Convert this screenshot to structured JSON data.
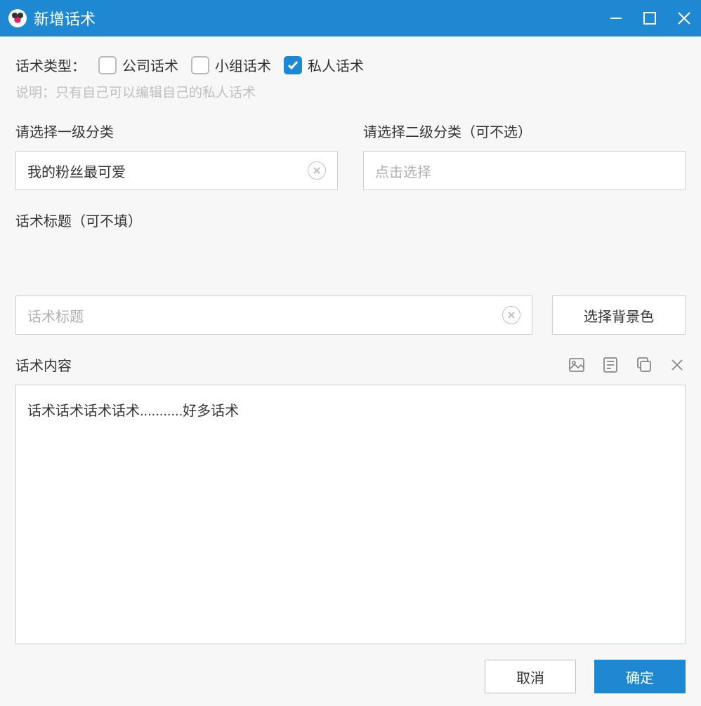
{
  "titlebar": {
    "title": "新增话术"
  },
  "typeSection": {
    "label": "话术类型：",
    "options": [
      {
        "label": "公司话术",
        "checked": false
      },
      {
        "label": "小组话术",
        "checked": false
      },
      {
        "label": "私人话术",
        "checked": true
      }
    ],
    "note": "说明：只有自己可以编辑自己的私人话术"
  },
  "category1": {
    "label": "请选择一级分类",
    "value": "我的粉丝最可爱"
  },
  "category2": {
    "label": "请选择二级分类（可不选）",
    "placeholder": "点击选择"
  },
  "titleField": {
    "label": "话术标题（可不填）",
    "placeholder": "话术标题",
    "bgButton": "选择背景色"
  },
  "content": {
    "label": "话术内容",
    "value": "话术话术话术话术...........好多话术"
  },
  "footer": {
    "cancel": "取消",
    "confirm": "确定"
  }
}
